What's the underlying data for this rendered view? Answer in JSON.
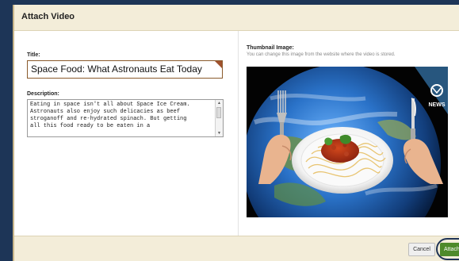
{
  "dialog": {
    "title": "Attach Video"
  },
  "form": {
    "title_label": "Title:",
    "title_value": "Space Food: What Astronauts Eat Today",
    "description_label": "Description:",
    "description_value": "Eating in space isn't all about Space Ice Cream.\nAstronauts also enjoy such delicacies as beef\nstroganoff and re-hydrated spinach. But getting\nall this food ready to be eaten in a"
  },
  "thumbnail": {
    "label": "Thumbnail Image:",
    "help": "You can change this image from the website where the video is stored.",
    "logo_text": "NEWS"
  },
  "footer": {
    "cancel_label": "Cancel",
    "attach_label": "Attach"
  },
  "colors": {
    "title_bar": "#f3edd9",
    "attach_button": "#4e8a2a",
    "input_border": "#8a5a2b",
    "backdrop": "#1d3557"
  },
  "icons": [
    "scroll-up-icon",
    "scroll-down-icon",
    "discovery-news-logo-icon"
  ]
}
